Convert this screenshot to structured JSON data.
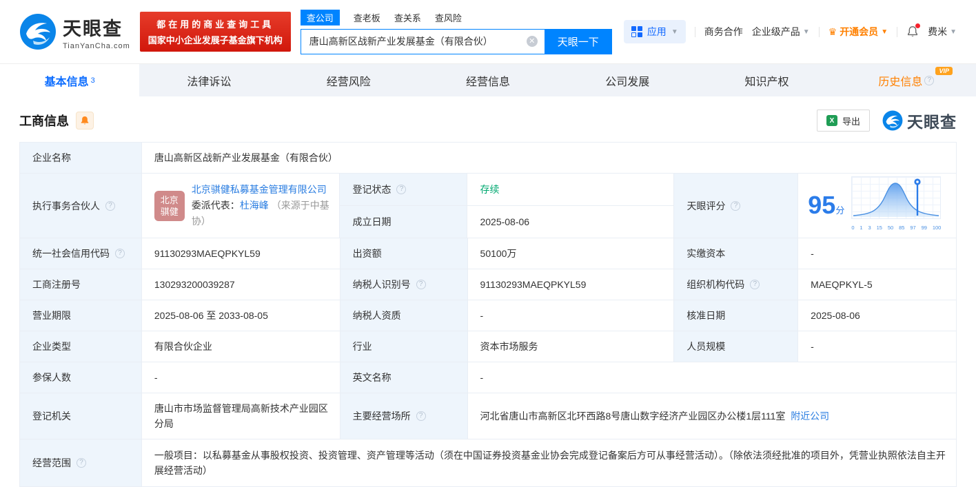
{
  "colors": {
    "brand_blue": "#0084ff",
    "link_blue": "#2a7de1",
    "status_green": "#00a870",
    "vip_orange": "#ff8000",
    "badge_red": "#d1170b",
    "score_blue": "#2b7ce9"
  },
  "header": {
    "brand": "天眼查",
    "brand_domain": "TianYanCha.com",
    "slogan_line1": "都在用的商业查询工具",
    "slogan_line2": "国家中小企业发展子基金旗下机构",
    "search": {
      "tabs": [
        "查公司",
        "查老板",
        "查关系",
        "查风险"
      ],
      "value": "唐山高新区战新产业发展基金（有限合伙）",
      "button": "天眼一下"
    },
    "nav": {
      "apps": "应用",
      "biz": "商务合作",
      "enterprise": "企业级产品",
      "vip": "开通会员",
      "user": "费米"
    }
  },
  "page_tabs": [
    {
      "label": "基本信息",
      "badge": "3"
    },
    {
      "label": "法律诉讼"
    },
    {
      "label": "经营风险"
    },
    {
      "label": "经营信息"
    },
    {
      "label": "公司发展"
    },
    {
      "label": "知识产权"
    },
    {
      "label": "历史信息",
      "vip": "VIP"
    }
  ],
  "section": {
    "title": "工商信息",
    "export_label": "导出",
    "watermark": "天眼查"
  },
  "fields": {
    "company_name": {
      "label": "企业名称",
      "value": "唐山高新区战新产业发展基金（有限合伙）"
    },
    "executive_partner": {
      "label": "执行事务合伙人",
      "avatar_line1": "北京",
      "avatar_line2": "骐健",
      "company_link": "北京骐健私募基金管理有限公司",
      "delegate_prefix": "委派代表：",
      "delegate_name": "杜海峰",
      "delegate_note": "（来源于中基协）"
    },
    "registration_status": {
      "label": "登记状态",
      "value": "存续"
    },
    "establish_date": {
      "label": "成立日期",
      "value": "2025-08-06"
    },
    "score": {
      "label": "天眼评分",
      "value": "95",
      "unit": "分",
      "axis": [
        "0",
        "1",
        "3",
        "15",
        "50",
        "85",
        "97",
        "99",
        "100"
      ]
    },
    "credit_code": {
      "label": "统一社会信用代码",
      "value": "91130293MAEQPKYL59"
    },
    "contribution": {
      "label": "出资额",
      "value": "50100万"
    },
    "paid_capital": {
      "label": "实缴资本",
      "value": "-"
    },
    "reg_number": {
      "label": "工商注册号",
      "value": "130293200039287"
    },
    "taxpayer_id": {
      "label": "纳税人识别号",
      "value": "91130293MAEQPKYL59"
    },
    "org_code": {
      "label": "组织机构代码",
      "value": "MAEQPKYL-5"
    },
    "business_term": {
      "label": "营业期限",
      "value": "2025-08-06 至 2033-08-05"
    },
    "taxpayer_quality": {
      "label": "纳税人资质",
      "value": "-"
    },
    "approval_date": {
      "label": "核准日期",
      "value": "2025-08-06"
    },
    "company_type": {
      "label": "企业类型",
      "value": "有限合伙企业"
    },
    "industry": {
      "label": "行业",
      "value": "资本市场服务"
    },
    "staff_size": {
      "label": "人员规模",
      "value": "-"
    },
    "insured_count": {
      "label": "参保人数",
      "value": "-"
    },
    "english_name": {
      "label": "英文名称",
      "value": "-"
    },
    "registry_authority": {
      "label": "登记机关",
      "value": "唐山市市场监督管理局高新技术产业园区分局"
    },
    "business_address": {
      "label": "主要经营场所",
      "value": "河北省唐山市高新区北环西路8号唐山数字经济产业园区办公楼1层111室",
      "nearby_link": "附近公司"
    },
    "business_scope": {
      "label": "经营范围",
      "value": "一般项目：以私募基金从事股权投资、投资管理、资产管理等活动（须在中国证券投资基金业协会完成登记备案后方可从事经营活动）。（除依法须经批准的项目外，凭营业执照依法自主开展经营活动）"
    }
  }
}
